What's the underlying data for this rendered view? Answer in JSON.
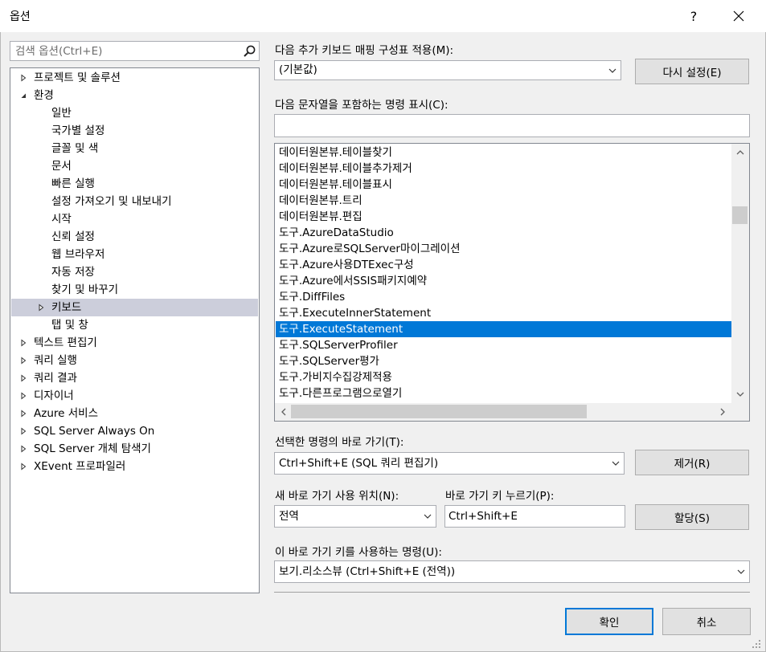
{
  "window": {
    "title": "옵션",
    "help_label": "?"
  },
  "search": {
    "placeholder": "검색 옵션(Ctrl+E)"
  },
  "tree": {
    "items": [
      {
        "label": "프로젝트 및 솔루션",
        "level": 0,
        "arrow": "collapsed"
      },
      {
        "label": "환경",
        "level": 0,
        "arrow": "expanded"
      },
      {
        "label": "일반",
        "level": 1,
        "arrow": "none"
      },
      {
        "label": "국가별 설정",
        "level": 1,
        "arrow": "none"
      },
      {
        "label": "글꼴 및 색",
        "level": 1,
        "arrow": "none"
      },
      {
        "label": "문서",
        "level": 1,
        "arrow": "none"
      },
      {
        "label": "빠른 실행",
        "level": 1,
        "arrow": "none"
      },
      {
        "label": "설정 가져오기 및 내보내기",
        "level": 1,
        "arrow": "none"
      },
      {
        "label": "시작",
        "level": 1,
        "arrow": "none"
      },
      {
        "label": "신뢰 설정",
        "level": 1,
        "arrow": "none"
      },
      {
        "label": "웹 브라우저",
        "level": 1,
        "arrow": "none"
      },
      {
        "label": "자동 저장",
        "level": 1,
        "arrow": "none"
      },
      {
        "label": "찾기 및 바꾸기",
        "level": 1,
        "arrow": "none"
      },
      {
        "label": "키보드",
        "level": 1,
        "arrow": "collapsed",
        "selected": true
      },
      {
        "label": "탭 및 창",
        "level": 1,
        "arrow": "none"
      },
      {
        "label": "텍스트 편집기",
        "level": 0,
        "arrow": "collapsed"
      },
      {
        "label": "쿼리 실행",
        "level": 0,
        "arrow": "collapsed"
      },
      {
        "label": "쿼리 결과",
        "level": 0,
        "arrow": "collapsed"
      },
      {
        "label": "디자이너",
        "level": 0,
        "arrow": "collapsed"
      },
      {
        "label": "Azure 서비스",
        "level": 0,
        "arrow": "collapsed"
      },
      {
        "label": "SQL Server Always On",
        "level": 0,
        "arrow": "collapsed"
      },
      {
        "label": "SQL Server 개체 탐색기",
        "level": 0,
        "arrow": "collapsed"
      },
      {
        "label": "XEvent 프로파일러",
        "level": 0,
        "arrow": "collapsed"
      }
    ]
  },
  "mapping": {
    "label": "다음 추가 키보드 매핑 구성표 적용(M):",
    "value": "(기본값)",
    "reset_label": "다시 설정(E)"
  },
  "filter": {
    "label": "다음 문자열을 포함하는 명령 표시(C):",
    "value": ""
  },
  "commands": {
    "items": [
      "데이터원본뷰.테이블찾기",
      "데이터원본뷰.테이블추가제거",
      "데이터원본뷰.테이블표시",
      "데이터원본뷰.트리",
      "데이터원본뷰.편집",
      "도구.AzureDataStudio",
      "도구.Azure로SQLServer마이그레이션",
      "도구.Azure사용DTExec구성",
      "도구.Azure에서SSIS패키지예약",
      "도구.DiffFiles",
      "도구.ExecuteInnerStatement",
      "도구.ExecuteStatement",
      "도구.SQLServerProfiler",
      "도구.SQLServer평가",
      "도구.가비지수집강제적용",
      "도구.다른프로그램으로열기"
    ],
    "selected_index": 11
  },
  "shortcut": {
    "label": "선택한 명령의 바로 가기(T):",
    "value": "Ctrl+Shift+E (SQL 쿼리 편집기)",
    "remove_label": "제거(R)"
  },
  "scope": {
    "label": "새 바로 가기 사용 위치(N):",
    "value": "전역"
  },
  "press_keys": {
    "label": "바로 가기 키 누르기(P):",
    "value": "Ctrl+Shift+E",
    "assign_label": "할당(S)"
  },
  "used_by": {
    "label": "이 바로 가기 키를 사용하는 명령(U):",
    "value": "보기.리소스뷰 (Ctrl+Shift+E (전역))"
  },
  "footer": {
    "ok_label": "확인",
    "cancel_label": "취소"
  },
  "colors": {
    "selection": "#0078d7",
    "tree_selection": "#cccedb"
  }
}
